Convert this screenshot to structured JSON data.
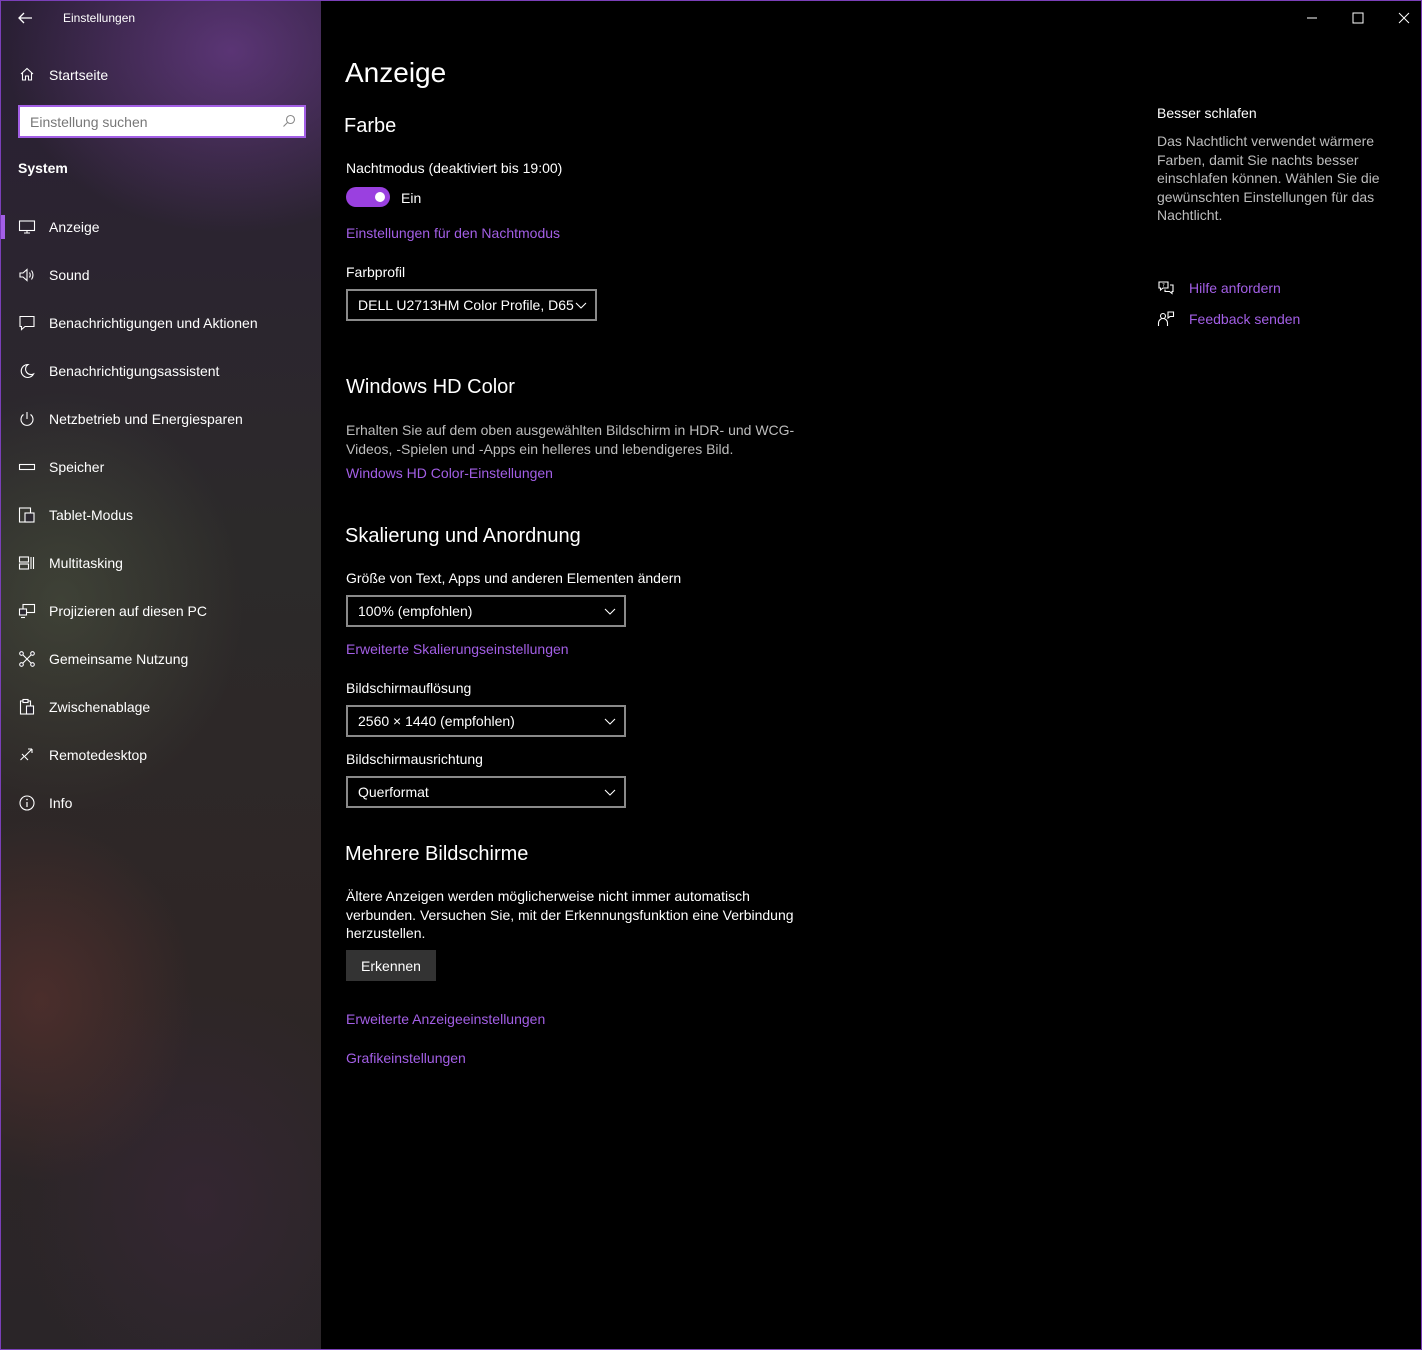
{
  "app": {
    "title": "Einstellungen"
  },
  "sidebar": {
    "home_label": "Startseite",
    "search_placeholder": "Einstellung suchen",
    "section_label": "System",
    "items": [
      {
        "label": "Anzeige",
        "icon": "monitor-icon",
        "active": true
      },
      {
        "label": "Sound",
        "icon": "speaker-icon"
      },
      {
        "label": "Benachrichtigungen und Aktionen",
        "icon": "message-icon"
      },
      {
        "label": "Benachrichtigungsassistent",
        "icon": "moon-icon"
      },
      {
        "label": "Netzbetrieb und Energiesparen",
        "icon": "power-icon"
      },
      {
        "label": "Speicher",
        "icon": "storage-icon"
      },
      {
        "label": "Tablet-Modus",
        "icon": "tablet-icon"
      },
      {
        "label": "Multitasking",
        "icon": "multitasking-icon"
      },
      {
        "label": "Projizieren auf diesen PC",
        "icon": "project-icon"
      },
      {
        "label": "Gemeinsame Nutzung",
        "icon": "share-icon"
      },
      {
        "label": "Zwischenablage",
        "icon": "clipboard-icon"
      },
      {
        "label": "Remotedesktop",
        "icon": "remote-icon"
      },
      {
        "label": "Info",
        "icon": "info-icon"
      }
    ]
  },
  "main": {
    "page_title": "Anzeige",
    "farbe": {
      "heading": "Farbe",
      "night_mode_label": "Nachtmodus (deaktiviert bis 19:00)",
      "toggle_state": "Ein",
      "night_settings_link": "Einstellungen für den Nachtmodus",
      "color_profile_label": "Farbprofil",
      "color_profile_value": "DELL U2713HM Color Profile, D65"
    },
    "hdr": {
      "heading": "Windows HD Color",
      "desc_line1": "Erhalten Sie auf dem oben ausgewählten Bildschirm in HDR- und WCG-",
      "desc_line2": "Videos, -Spielen und -Apps ein helleres und lebendigeres Bild.",
      "link": "Windows HD Color-Einstellungen"
    },
    "scaling": {
      "heading": "Skalierung und Anordnung",
      "size_label": "Größe von Text, Apps und anderen Elementen ändern",
      "size_value": "100% (empfohlen)",
      "advanced_link": "Erweiterte Skalierungseinstellungen",
      "resolution_label": "Bildschirmauflösung",
      "resolution_value": "2560 × 1440 (empfohlen)",
      "orientation_label": "Bildschirmausrichtung",
      "orientation_value": "Querformat"
    },
    "multi": {
      "heading": "Mehrere Bildschirme",
      "desc_line1": "Ältere Anzeigen werden möglicherweise nicht immer automatisch",
      "desc_line2": "verbunden. Versuchen Sie, mit der Erkennungsfunktion eine Verbindung",
      "desc_line3": "herzustellen.",
      "detect_button": "Erkennen",
      "advanced_display_link": "Erweiterte Anzeigeeinstellungen",
      "graphics_link": "Grafikeinstellungen"
    }
  },
  "aside": {
    "title": "Besser schlafen",
    "desc_line1": "Das Nachtlicht verwendet wärmere",
    "desc_line2": "Farben, damit Sie nachts besser",
    "desc_line3": "einschlafen können. Wählen Sie die",
    "desc_line4": "gewünschten Einstellungen für das",
    "desc_line5": "Nachtlicht.",
    "help_link": "Hilfe anfordern",
    "feedback_link": "Feedback senden"
  },
  "colors": {
    "accent": "#a35fe6",
    "toggle": "#9a40e0",
    "background": "#000000"
  }
}
